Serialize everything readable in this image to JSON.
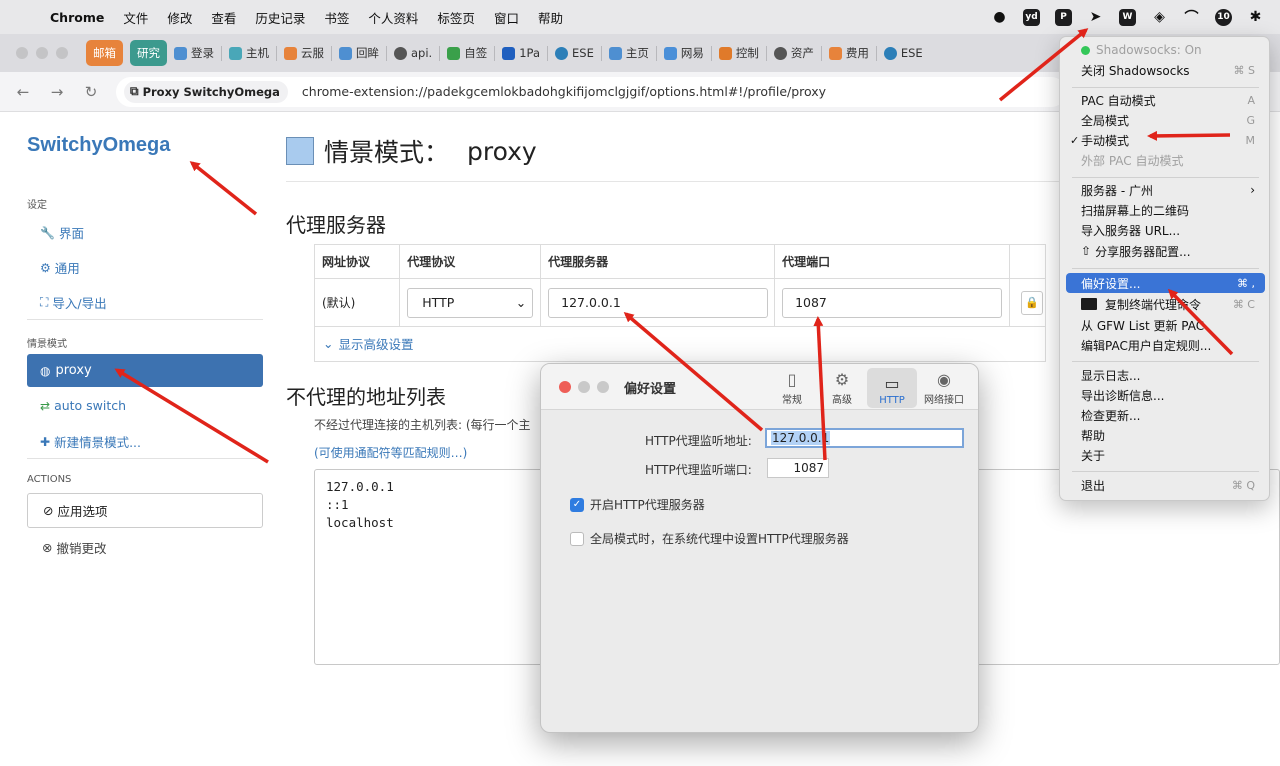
{
  "menubar": {
    "items": [
      "Chrome",
      "文件",
      "修改",
      "查看",
      "历史记录",
      "书签",
      "个人资料",
      "标签页",
      "窗口",
      "帮助"
    ],
    "tray": [
      "wechat-icon",
      "yd-icon",
      "p-icon",
      "shadowsocks-plane-icon",
      "w-icon",
      "layers-icon",
      "airpods-icon",
      "badge-icon",
      "bluetooth-icon"
    ],
    "tray_labels": {
      "yd": "yd",
      "p": "P",
      "w": "W",
      "badge": "10"
    }
  },
  "tabs": [
    {
      "label": "邮箱",
      "style": "orange"
    },
    {
      "label": "研究",
      "style": "teal"
    },
    {
      "label": "登录"
    },
    {
      "label": "主机"
    },
    {
      "label": "云服"
    },
    {
      "label": "回眸"
    },
    {
      "label": "api."
    },
    {
      "label": "自签"
    },
    {
      "label": "1Pa"
    },
    {
      "label": "ESE"
    },
    {
      "label": "主页"
    },
    {
      "label": "网易"
    },
    {
      "label": "控制"
    },
    {
      "label": "资产"
    },
    {
      "label": "费用"
    },
    {
      "label": "ESE"
    }
  ],
  "addressbar": {
    "chip_label": "Proxy SwitchyOmega",
    "url": "chrome-extension://padekgcemlokbadohgkifijomclgjgif/options.html#!/profile/proxy"
  },
  "sidebar": {
    "brand": "SwitchyOmega",
    "settings_header": "设定",
    "settings_items": [
      "界面",
      "通用",
      "导入/导出"
    ],
    "profiles_header": "情景模式",
    "active_profile": "proxy",
    "profile_items": [
      "auto switch",
      "新建情景模式..."
    ],
    "actions_header": "ACTIONS",
    "apply_label": "应用选项",
    "discard_label": "撤销更改"
  },
  "main": {
    "title_label": "情景模式：",
    "title_value": "proxy",
    "proxy_servers_heading": "代理服务器",
    "table": {
      "headers": [
        "网址协议",
        "代理协议",
        "代理服务器",
        "代理端口"
      ],
      "row": {
        "scheme": "(默认)",
        "protocol": "HTTP",
        "server": "127.0.0.1",
        "port": "1087"
      }
    },
    "advanced_link": "显示高级设置",
    "bypass_heading": "不代理的地址列表",
    "bypass_desc": "不经过代理连接的主机列表: (每行一个主",
    "bypass_link": "(可使用通配符等匹配规则…)",
    "bypass_list": [
      "127.0.0.1",
      "::1",
      "localhost"
    ]
  },
  "dialog": {
    "title": "偏好设置",
    "tabs": [
      "常规",
      "高级",
      "HTTP",
      "网络接口"
    ],
    "active_tab": "HTTP",
    "listen_addr_label": "HTTP代理监听地址:",
    "listen_addr_value": "127.0.0.1",
    "listen_port_label": "HTTP代理监听端口:",
    "listen_port_value": "1087",
    "enable_http_label": "开启HTTP代理服务器",
    "global_mode_label": "全局模式时，在系统代理中设置HTTP代理服务器"
  },
  "ssmenu": {
    "status": "Shadowsocks: On",
    "toggle": {
      "label": "关闭 Shadowsocks",
      "shortcut": "⌘ S"
    },
    "pac_auto": {
      "label": "PAC 自动模式",
      "shortcut": "A"
    },
    "global": {
      "label": "全局模式",
      "shortcut": "G"
    },
    "manual": {
      "label": "手动模式",
      "shortcut": "M"
    },
    "external_pac": {
      "label": "外部 PAC 自动模式"
    },
    "server": {
      "label": "服务器 - 广州",
      "shortcut": "›"
    },
    "scan_qr": {
      "label": "扫描屏幕上的二维码"
    },
    "import_url": {
      "label": "导入服务器 URL..."
    },
    "share": {
      "label": "分享服务器配置..."
    },
    "preferences": {
      "label": "偏好设置...",
      "shortcut": "⌘ ,"
    },
    "copy_terminal": {
      "label": "复制终端代理命令",
      "shortcut": "⌘ C"
    },
    "update_gfw": {
      "label": "从 GFW List 更新 PAC"
    },
    "edit_pac": {
      "label": "编辑PAC用户自定规则..."
    },
    "show_log": {
      "label": "显示日志..."
    },
    "export_diag": {
      "label": "导出诊断信息..."
    },
    "check_update": {
      "label": "检查更新..."
    },
    "help": {
      "label": "帮助"
    },
    "about": {
      "label": "关于"
    },
    "quit": {
      "label": "退出",
      "shortcut": "⌘ Q"
    }
  },
  "colors": {
    "brand": "#3a78b8",
    "active": "#3d72b0",
    "arrow": "#e0241a",
    "menu_highlight": "#3a74d6"
  }
}
